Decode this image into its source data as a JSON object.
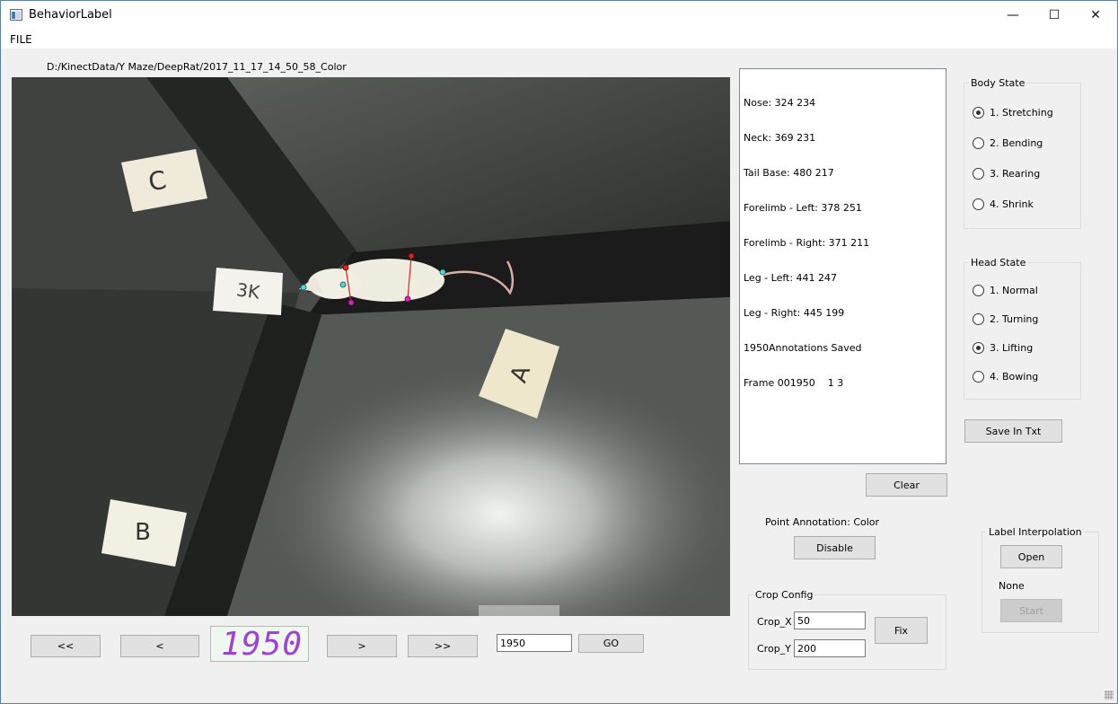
{
  "window": {
    "title": "BehaviorLabel",
    "minimize_glyph": "—",
    "maximize_glyph": "☐",
    "close_glyph": "✕"
  },
  "menu": {
    "file": "FILE"
  },
  "video": {
    "path": "D:/KinectData/Y Maze/DeepRat/2017_11_17_14_50_58_Color",
    "markers": [
      "C",
      "3K",
      "A",
      "B"
    ]
  },
  "log_lines": [
    "Nose: 324 234",
    "Neck: 369 231",
    "Tail Base: 480 217",
    "Forelimb - Left: 378 251",
    "Forelimb - Right: 371 211",
    "Leg - Left: 441 247",
    "Leg - Right: 445 199",
    "1950Annotations Saved",
    "Frame 001950    1 3"
  ],
  "buttons": {
    "clear": "Clear",
    "disable": "Disable",
    "save_txt": "Save In Txt",
    "fix": "Fix",
    "open": "Open",
    "start": "Start",
    "first": "<<",
    "prev": "<",
    "next": ">",
    "last": ">>",
    "go": "GO"
  },
  "body_state": {
    "title": "Body State",
    "options": [
      "1. Stretching",
      "2. Bending",
      "3. Rearing",
      "4. Shrink"
    ],
    "selected": 0
  },
  "head_state": {
    "title": "Head State",
    "options": [
      "1. Normal",
      "2. Turning",
      "3. Lifting",
      "4. Bowing"
    ],
    "selected": 2
  },
  "point_annotation": "Point Annotation: Color",
  "label_interpolation": {
    "title": "Label Interpolation",
    "status": "None"
  },
  "crop": {
    "title": "Crop Config",
    "x_label": "Crop_X",
    "x_value": "50",
    "y_label": "Crop_Y",
    "y_value": "200"
  },
  "frame": {
    "lcd": "1950",
    "goto_value": "1950"
  },
  "colors": {
    "lcd_digits": "#a040d8",
    "keypoint_cyan": "#40e0e0",
    "keypoint_red": "#e02020",
    "keypoint_magenta": "#e020c0"
  }
}
